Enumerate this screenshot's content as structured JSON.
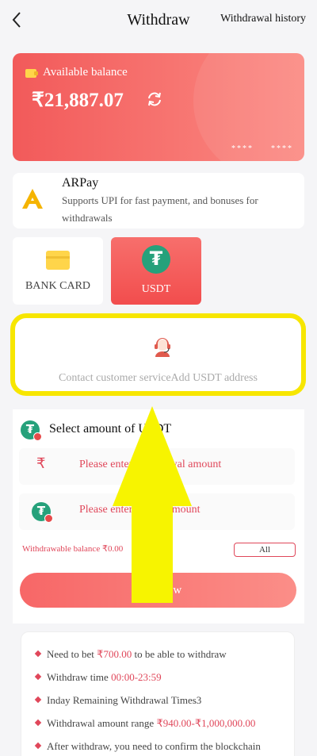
{
  "header": {
    "back_icon": "chevron-left-icon",
    "title": "Withdraw",
    "history_link": "Withdrawal history"
  },
  "balance": {
    "label": "Available balance",
    "amount": "₹21,887.07",
    "masked_1": "****",
    "masked_2": "****",
    "gradient_from": "#f25a5a",
    "gradient_to": "#fb8a83"
  },
  "arpay": {
    "name": "ARPay",
    "description": "Supports UPI for fast payment, and bonuses for withdrawals"
  },
  "methods": [
    {
      "label": "BANK CARD",
      "icon": "bank-card-icon",
      "selected": false
    },
    {
      "label": "USDT",
      "icon": "tether-icon",
      "selected": true
    }
  ],
  "contact": {
    "text": "Contact customer serviceAdd USDT address",
    "icon": "customer-service-agent-icon",
    "highlight_color": "#f7e600"
  },
  "select": {
    "title": "Select amount of USDT",
    "inr_placeholder": "Please enter withdrawal amount",
    "usdt_placeholder": "Please enter USDT amount"
  },
  "withdrawable": {
    "label": "Withdrawable balance ₹0.00",
    "all_button": "All"
  },
  "withdraw_button": "Withdraw",
  "rules": [
    {
      "pre": "Need to bet ",
      "hl": "₹700.00",
      "post": " to be able to withdraw"
    },
    {
      "pre": "Withdraw time ",
      "hl": "00:00-23:59",
      "post": ""
    },
    {
      "pre": "Inday Remaining Withdrawal Times3",
      "hl": "",
      "post": ""
    },
    {
      "pre": "Withdrawal amount range ",
      "hl": "₹940.00-₹1,000,000.00",
      "post": ""
    },
    {
      "pre": "After withdraw, you need to confirm the blockchain",
      "hl": "",
      "post": ""
    }
  ],
  "annotation": {
    "arrow_color": "#f7f400",
    "arrow_icon": "up-arrow-icon"
  },
  "colors": {
    "accent": "#e0475a",
    "tether_green": "#26a17b"
  }
}
